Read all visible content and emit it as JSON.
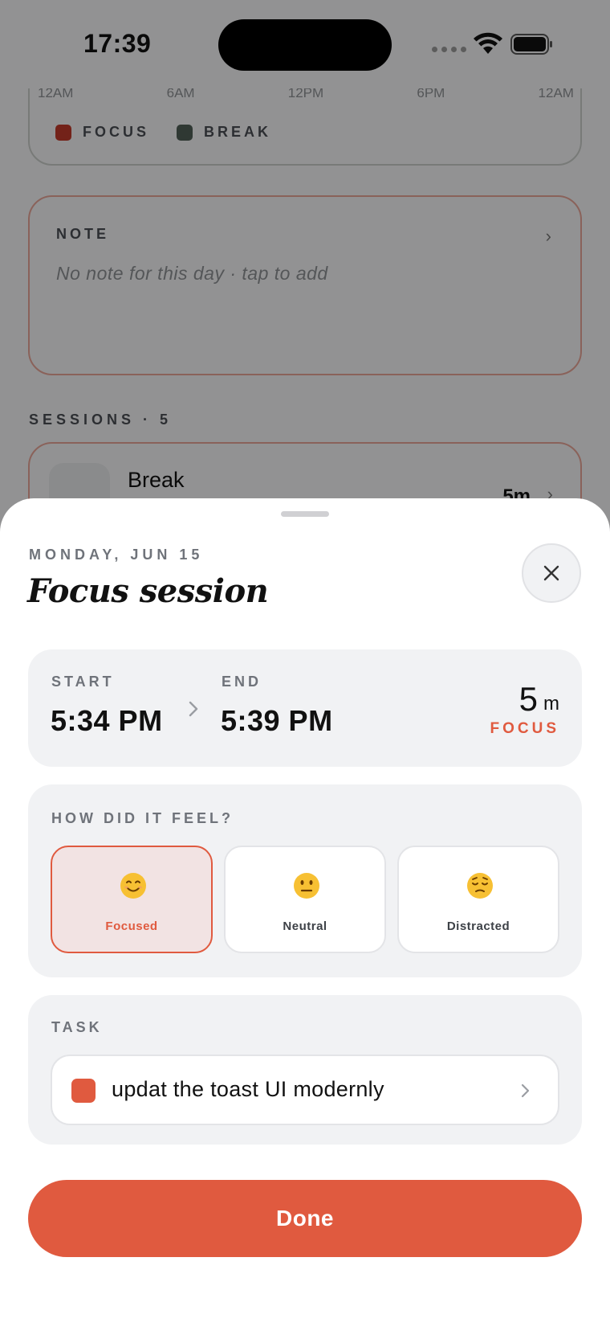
{
  "status_bar": {
    "time": "17:39"
  },
  "background": {
    "timeline_ticks": [
      "12AM",
      "6AM",
      "12PM",
      "6PM",
      "12AM"
    ],
    "legend": [
      {
        "label": "FOCUS",
        "color": "#c0392b"
      },
      {
        "label": "BREAK",
        "color": "#4f5e56"
      }
    ],
    "note": {
      "label": "NOTE",
      "placeholder": "No note for this day · tap to add"
    },
    "sessions_label": "SESSIONS · 5",
    "session": {
      "name": "Break",
      "duration": "5m"
    }
  },
  "sheet": {
    "date_label": "MONDAY, JUN 15",
    "title": "Focus session",
    "times": {
      "start_label": "START",
      "start_value": "5:34 PM",
      "end_label": "END",
      "end_value": "5:39 PM",
      "duration_number": "5",
      "duration_unit": "m",
      "session_type": "FOCUS"
    },
    "feel": {
      "label": "HOW DID IT FEEL?",
      "options": [
        {
          "label": "Focused",
          "emoji": "smiling-face-icon",
          "selected": true
        },
        {
          "label": "Neutral",
          "emoji": "neutral-face-icon",
          "selected": false
        },
        {
          "label": "Distracted",
          "emoji": "pensive-face-icon",
          "selected": false
        }
      ]
    },
    "task": {
      "label": "TASK",
      "name": "updat the toast UI modernly",
      "color": "#e05a3f"
    },
    "done_label": "Done"
  },
  "colors": {
    "accent": "#e05a3f",
    "panel": "#f1f2f4"
  }
}
